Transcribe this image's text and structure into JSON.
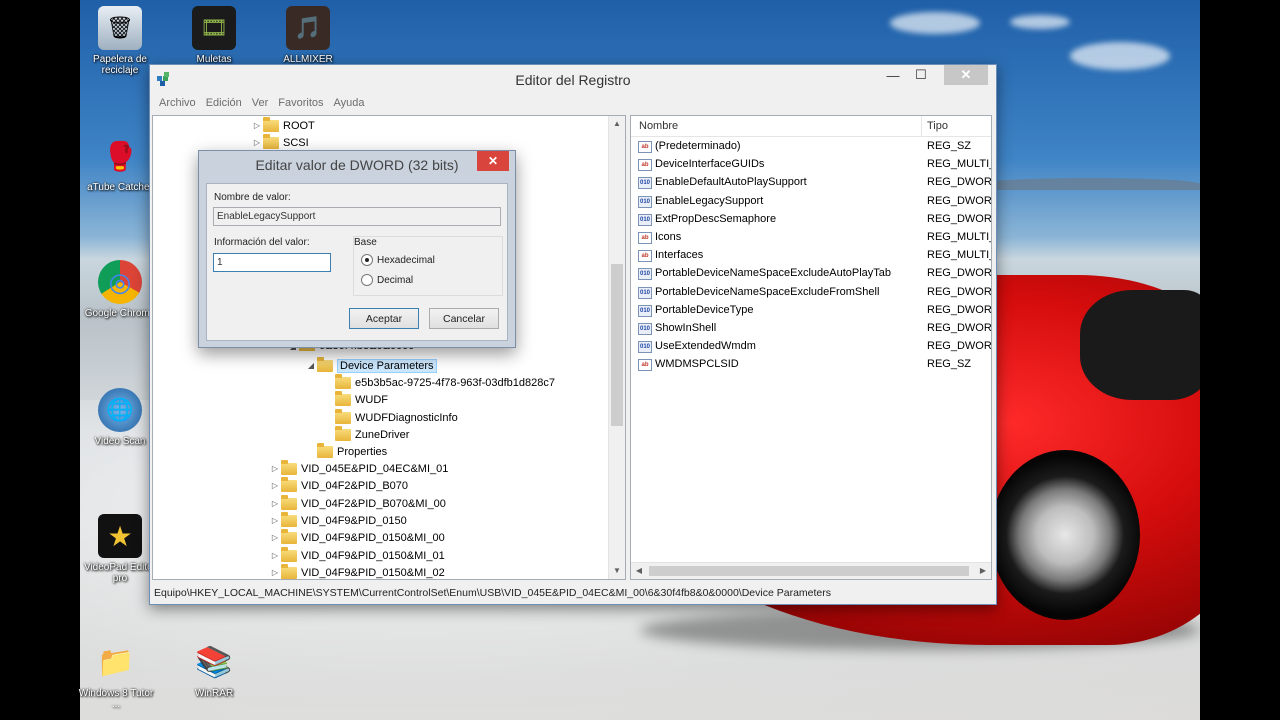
{
  "desktop": {
    "icons": [
      {
        "label": "Papelera de reciclaje",
        "icon": "recycle-bin-icon",
        "glyph": "🗑"
      },
      {
        "label": "Muletas Tutoriales",
        "icon": "video-icon",
        "glyph": "🎞"
      },
      {
        "label": "ALLMIXER",
        "icon": "media-icon",
        "glyph": "🎵"
      },
      {
        "label": "aTube Catcher",
        "icon": "atube-catcher-icon",
        "glyph": "🥊"
      },
      {
        "label": "Google Chrome",
        "icon": "chrome-icon",
        "glyph": "◎"
      },
      {
        "label": "Video Scan",
        "icon": "video-scan-icon",
        "glyph": "🌐"
      },
      {
        "label": "VideoPad Editor pro",
        "icon": "videopad-icon",
        "glyph": "★"
      },
      {
        "label": "Windows 8 Tutor ...",
        "icon": "folder-icon",
        "glyph": "📁"
      },
      {
        "label": "WinRAR",
        "icon": "winrar-icon",
        "glyph": "📚"
      }
    ]
  },
  "window": {
    "title": "Editor del Registro",
    "minimize": "—",
    "maximize": "☐",
    "close": "✕",
    "menu": [
      "Archivo",
      "Edición",
      "Ver",
      "Favoritos",
      "Ayuda"
    ]
  },
  "tree": {
    "top_items": [
      "ROOT",
      "SCSI"
    ],
    "partial_item": "6&30f4fb8&0&0000",
    "selected": "Device Parameters",
    "children": [
      "e5b3b5ac-9725-4f78-963f-03dfb1d828c7",
      "WUDF",
      "WUDFDiagnosticInfo",
      "ZuneDriver"
    ],
    "properties": "Properties",
    "siblings": [
      "VID_045E&PID_04EC&MI_01",
      "VID_04F2&PID_B070",
      "VID_04F2&PID_B070&MI_00",
      "VID_04F9&PID_0150",
      "VID_04F9&PID_0150&MI_00",
      "VID_04F9&PID_0150&MI_01",
      "VID_04F9&PID_0150&MI_02"
    ]
  },
  "list": {
    "col_name": "Nombre",
    "col_type": "Tipo",
    "rows": [
      {
        "name": "(Predeterminado)",
        "type": "REG_SZ",
        "kind": "ab"
      },
      {
        "name": "DeviceInterfaceGUIDs",
        "type": "REG_MULTI_",
        "kind": "ab"
      },
      {
        "name": "EnableDefaultAutoPlaySupport",
        "type": "REG_DWORI",
        "kind": "bin"
      },
      {
        "name": "EnableLegacySupport",
        "type": "REG_DWORI",
        "kind": "bin"
      },
      {
        "name": "ExtPropDescSemaphore",
        "type": "REG_DWORI",
        "kind": "bin"
      },
      {
        "name": "Icons",
        "type": "REG_MULTI_",
        "kind": "ab"
      },
      {
        "name": "Interfaces",
        "type": "REG_MULTI_",
        "kind": "ab"
      },
      {
        "name": "PortableDeviceNameSpaceExcludeAutoPlayTab",
        "type": "REG_DWORI",
        "kind": "bin"
      },
      {
        "name": "PortableDeviceNameSpaceExcludeFromShell",
        "type": "REG_DWORI",
        "kind": "bin"
      },
      {
        "name": "PortableDeviceType",
        "type": "REG_DWORI",
        "kind": "bin"
      },
      {
        "name": "ShowInShell",
        "type": "REG_DWORI",
        "kind": "bin"
      },
      {
        "name": "UseExtendedWmdm",
        "type": "REG_DWORI",
        "kind": "bin"
      },
      {
        "name": "WMDMSPCLSID",
        "type": "REG_SZ",
        "kind": "ab"
      }
    ]
  },
  "status": "Equipo\\HKEY_LOCAL_MACHINE\\SYSTEM\\CurrentControlSet\\Enum\\USB\\VID_045E&PID_04EC&MI_00\\6&30f4fb8&0&0000\\Device Parameters",
  "dialog": {
    "title": "Editar valor de DWORD (32 bits)",
    "close": "✕",
    "name_label": "Nombre de valor:",
    "name_value": "EnableLegacySupport",
    "data_label": "Información del valor:",
    "data_value": "1",
    "base_label": "Base",
    "hex_label": "Hexadecimal",
    "dec_label": "Decimal",
    "ok_label": "Aceptar",
    "cancel_label": "Cancelar"
  }
}
